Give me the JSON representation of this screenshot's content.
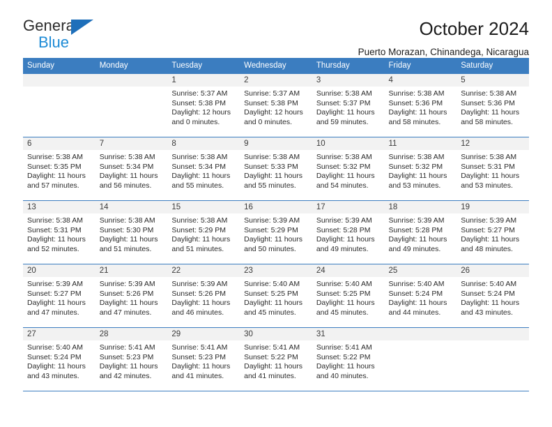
{
  "brand": {
    "name_top": "General",
    "name_bottom": "Blue",
    "accent_color": "#1e8bd6",
    "triangle_color": "#1e6fba"
  },
  "header": {
    "title": "October 2024",
    "subtitle": "Puerto Morazan, Chinandega, Nicaragua"
  },
  "calendar": {
    "header_bg": "#3b7dc0",
    "daynum_bg": "#f2f2f2",
    "weekday_headers": [
      "Sunday",
      "Monday",
      "Tuesday",
      "Wednesday",
      "Thursday",
      "Friday",
      "Saturday"
    ],
    "weeks": [
      [
        {
          "day": "",
          "empty": true
        },
        {
          "day": "",
          "empty": true
        },
        {
          "day": "1",
          "sunrise": "Sunrise: 5:37 AM",
          "sunset": "Sunset: 5:38 PM",
          "daylight_1": "Daylight: 12 hours",
          "daylight_2": "and 0 minutes."
        },
        {
          "day": "2",
          "sunrise": "Sunrise: 5:37 AM",
          "sunset": "Sunset: 5:38 PM",
          "daylight_1": "Daylight: 12 hours",
          "daylight_2": "and 0 minutes."
        },
        {
          "day": "3",
          "sunrise": "Sunrise: 5:38 AM",
          "sunset": "Sunset: 5:37 PM",
          "daylight_1": "Daylight: 11 hours",
          "daylight_2": "and 59 minutes."
        },
        {
          "day": "4",
          "sunrise": "Sunrise: 5:38 AM",
          "sunset": "Sunset: 5:36 PM",
          "daylight_1": "Daylight: 11 hours",
          "daylight_2": "and 58 minutes."
        },
        {
          "day": "5",
          "sunrise": "Sunrise: 5:38 AM",
          "sunset": "Sunset: 5:36 PM",
          "daylight_1": "Daylight: 11 hours",
          "daylight_2": "and 58 minutes."
        }
      ],
      [
        {
          "day": "6",
          "sunrise": "Sunrise: 5:38 AM",
          "sunset": "Sunset: 5:35 PM",
          "daylight_1": "Daylight: 11 hours",
          "daylight_2": "and 57 minutes."
        },
        {
          "day": "7",
          "sunrise": "Sunrise: 5:38 AM",
          "sunset": "Sunset: 5:34 PM",
          "daylight_1": "Daylight: 11 hours",
          "daylight_2": "and 56 minutes."
        },
        {
          "day": "8",
          "sunrise": "Sunrise: 5:38 AM",
          "sunset": "Sunset: 5:34 PM",
          "daylight_1": "Daylight: 11 hours",
          "daylight_2": "and 55 minutes."
        },
        {
          "day": "9",
          "sunrise": "Sunrise: 5:38 AM",
          "sunset": "Sunset: 5:33 PM",
          "daylight_1": "Daylight: 11 hours",
          "daylight_2": "and 55 minutes."
        },
        {
          "day": "10",
          "sunrise": "Sunrise: 5:38 AM",
          "sunset": "Sunset: 5:32 PM",
          "daylight_1": "Daylight: 11 hours",
          "daylight_2": "and 54 minutes."
        },
        {
          "day": "11",
          "sunrise": "Sunrise: 5:38 AM",
          "sunset": "Sunset: 5:32 PM",
          "daylight_1": "Daylight: 11 hours",
          "daylight_2": "and 53 minutes."
        },
        {
          "day": "12",
          "sunrise": "Sunrise: 5:38 AM",
          "sunset": "Sunset: 5:31 PM",
          "daylight_1": "Daylight: 11 hours",
          "daylight_2": "and 53 minutes."
        }
      ],
      [
        {
          "day": "13",
          "sunrise": "Sunrise: 5:38 AM",
          "sunset": "Sunset: 5:31 PM",
          "daylight_1": "Daylight: 11 hours",
          "daylight_2": "and 52 minutes."
        },
        {
          "day": "14",
          "sunrise": "Sunrise: 5:38 AM",
          "sunset": "Sunset: 5:30 PM",
          "daylight_1": "Daylight: 11 hours",
          "daylight_2": "and 51 minutes."
        },
        {
          "day": "15",
          "sunrise": "Sunrise: 5:38 AM",
          "sunset": "Sunset: 5:29 PM",
          "daylight_1": "Daylight: 11 hours",
          "daylight_2": "and 51 minutes."
        },
        {
          "day": "16",
          "sunrise": "Sunrise: 5:39 AM",
          "sunset": "Sunset: 5:29 PM",
          "daylight_1": "Daylight: 11 hours",
          "daylight_2": "and 50 minutes."
        },
        {
          "day": "17",
          "sunrise": "Sunrise: 5:39 AM",
          "sunset": "Sunset: 5:28 PM",
          "daylight_1": "Daylight: 11 hours",
          "daylight_2": "and 49 minutes."
        },
        {
          "day": "18",
          "sunrise": "Sunrise: 5:39 AM",
          "sunset": "Sunset: 5:28 PM",
          "daylight_1": "Daylight: 11 hours",
          "daylight_2": "and 49 minutes."
        },
        {
          "day": "19",
          "sunrise": "Sunrise: 5:39 AM",
          "sunset": "Sunset: 5:27 PM",
          "daylight_1": "Daylight: 11 hours",
          "daylight_2": "and 48 minutes."
        }
      ],
      [
        {
          "day": "20",
          "sunrise": "Sunrise: 5:39 AM",
          "sunset": "Sunset: 5:27 PM",
          "daylight_1": "Daylight: 11 hours",
          "daylight_2": "and 47 minutes."
        },
        {
          "day": "21",
          "sunrise": "Sunrise: 5:39 AM",
          "sunset": "Sunset: 5:26 PM",
          "daylight_1": "Daylight: 11 hours",
          "daylight_2": "and 47 minutes."
        },
        {
          "day": "22",
          "sunrise": "Sunrise: 5:39 AM",
          "sunset": "Sunset: 5:26 PM",
          "daylight_1": "Daylight: 11 hours",
          "daylight_2": "and 46 minutes."
        },
        {
          "day": "23",
          "sunrise": "Sunrise: 5:40 AM",
          "sunset": "Sunset: 5:25 PM",
          "daylight_1": "Daylight: 11 hours",
          "daylight_2": "and 45 minutes."
        },
        {
          "day": "24",
          "sunrise": "Sunrise: 5:40 AM",
          "sunset": "Sunset: 5:25 PM",
          "daylight_1": "Daylight: 11 hours",
          "daylight_2": "and 45 minutes."
        },
        {
          "day": "25",
          "sunrise": "Sunrise: 5:40 AM",
          "sunset": "Sunset: 5:24 PM",
          "daylight_1": "Daylight: 11 hours",
          "daylight_2": "and 44 minutes."
        },
        {
          "day": "26",
          "sunrise": "Sunrise: 5:40 AM",
          "sunset": "Sunset: 5:24 PM",
          "daylight_1": "Daylight: 11 hours",
          "daylight_2": "and 43 minutes."
        }
      ],
      [
        {
          "day": "27",
          "sunrise": "Sunrise: 5:40 AM",
          "sunset": "Sunset: 5:24 PM",
          "daylight_1": "Daylight: 11 hours",
          "daylight_2": "and 43 minutes."
        },
        {
          "day": "28",
          "sunrise": "Sunrise: 5:41 AM",
          "sunset": "Sunset: 5:23 PM",
          "daylight_1": "Daylight: 11 hours",
          "daylight_2": "and 42 minutes."
        },
        {
          "day": "29",
          "sunrise": "Sunrise: 5:41 AM",
          "sunset": "Sunset: 5:23 PM",
          "daylight_1": "Daylight: 11 hours",
          "daylight_2": "and 41 minutes."
        },
        {
          "day": "30",
          "sunrise": "Sunrise: 5:41 AM",
          "sunset": "Sunset: 5:22 PM",
          "daylight_1": "Daylight: 11 hours",
          "daylight_2": "and 41 minutes."
        },
        {
          "day": "31",
          "sunrise": "Sunrise: 5:41 AM",
          "sunset": "Sunset: 5:22 PM",
          "daylight_1": "Daylight: 11 hours",
          "daylight_2": "and 40 minutes."
        },
        {
          "day": "",
          "empty": true
        },
        {
          "day": "",
          "empty": true
        }
      ]
    ]
  }
}
